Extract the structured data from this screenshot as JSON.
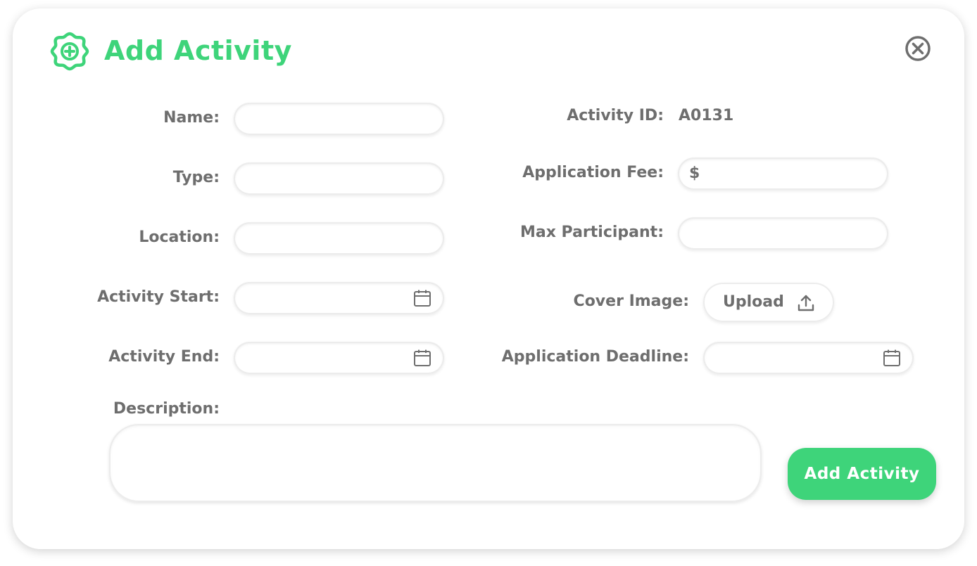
{
  "dialog": {
    "title": "Add Activity",
    "header_icon": "plus-badge-icon",
    "close_icon": "close-circle-icon",
    "accent_color": "#3ed47a"
  },
  "form": {
    "name": {
      "label": "Name:",
      "value": ""
    },
    "type": {
      "label": "Type:",
      "value": ""
    },
    "location": {
      "label": "Location:",
      "value": ""
    },
    "activity_start": {
      "label": "Activity Start:",
      "value": "",
      "icon": "calendar-icon"
    },
    "activity_end": {
      "label": "Activity End:",
      "value": "",
      "icon": "calendar-icon"
    },
    "activity_id": {
      "label": "Activity ID:",
      "value": "A0131"
    },
    "application_fee": {
      "label": "Application Fee:",
      "prefix": "$",
      "value": ""
    },
    "max_participant": {
      "label": "Max Participant:",
      "value": ""
    },
    "cover_image": {
      "label": "Cover Image:",
      "button_label": "Upload",
      "icon": "upload-icon"
    },
    "application_deadline": {
      "label": "Application Deadline:",
      "value": "",
      "icon": "calendar-icon"
    },
    "description": {
      "label": "Description:",
      "value": ""
    }
  },
  "actions": {
    "submit_label": "Add Activity"
  }
}
